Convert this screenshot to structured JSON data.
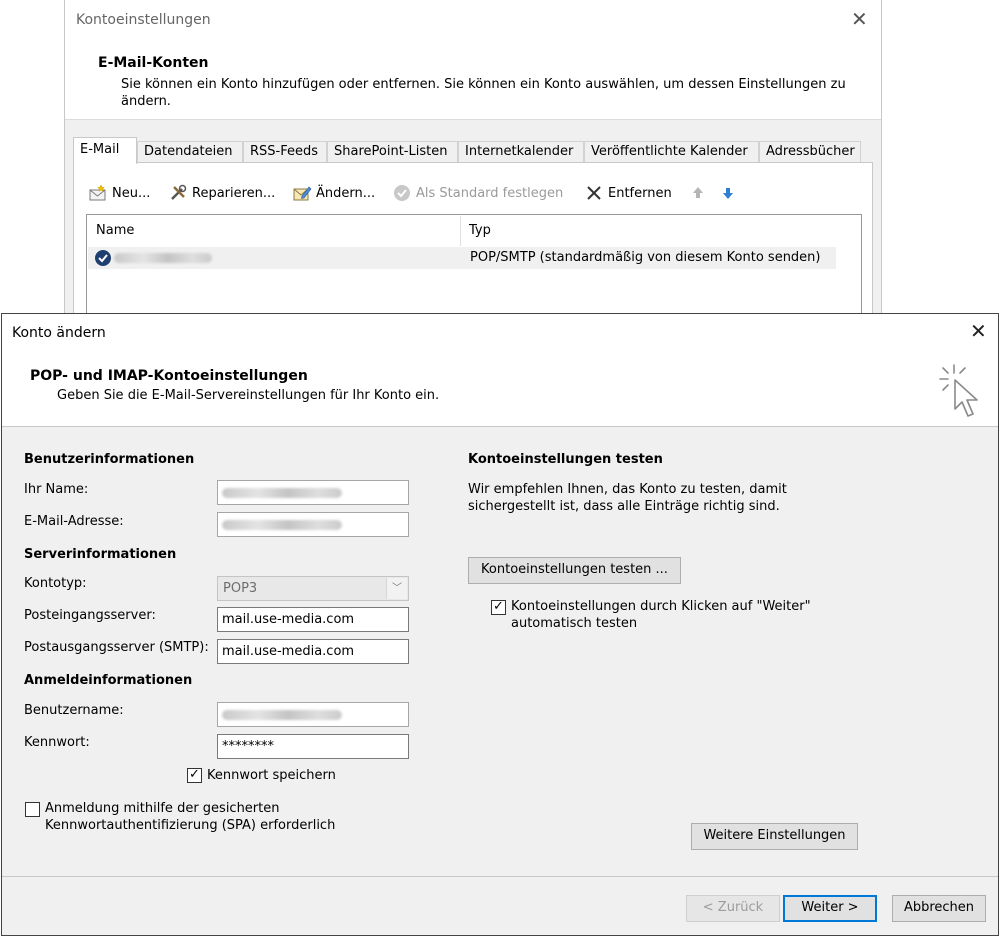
{
  "background_window": {
    "title": "Kontoeinstellungen",
    "close_glyph": "✕",
    "header_title": "E-Mail-Konten",
    "header_desc": "Sie können ein Konto hinzufügen oder entfernen. Sie können ein Konto auswählen, um dessen Einstellungen zu ändern.",
    "tabs": [
      "E-Mail",
      "Datendateien",
      "RSS-Feeds",
      "SharePoint-Listen",
      "Internetkalender",
      "Veröffentlichte Kalender",
      "Adressbücher"
    ],
    "toolbar": {
      "new_label": "Neu...",
      "repair_label": "Reparieren...",
      "change_label": "Ändern...",
      "set_default_label": "Als Standard festlegen",
      "remove_label": "Entfernen",
      "up_icon": "arrow-up-icon",
      "down_icon": "arrow-down-icon"
    },
    "account_list": {
      "col_name": "Name",
      "col_type": "Typ",
      "rows": [
        {
          "name": "",
          "type": "POP/SMTP (standardmäßig von diesem Konto senden)"
        }
      ]
    }
  },
  "dialog": {
    "title": "Konto ändern",
    "close_glyph": "✕",
    "header_title": "POP- und IMAP-Kontoeinstellungen",
    "header_desc": "Geben Sie die E-Mail-Servereinstellungen für Ihr Konto ein.",
    "user_info": {
      "section": "Benutzerinformationen",
      "name_label": "Ihr Name:",
      "email_label": "E-Mail-Adresse:"
    },
    "server_info": {
      "section": "Serverinformationen",
      "account_type_label": "Kontotyp:",
      "account_type_value": "POP3",
      "incoming_label": "Posteingangsserver:",
      "incoming_value": "mail.use-media.com",
      "outgoing_label": "Postausgangsserver (SMTP):",
      "outgoing_value": "mail.use-media.com"
    },
    "login_info": {
      "section": "Anmeldeinformationen",
      "username_label": "Benutzername:",
      "password_label": "Kennwort:",
      "password_value": "********",
      "remember_label": "Kennwort speichern",
      "remember_checked": true
    },
    "spa": {
      "label_line1": "Anmeldung mithilfe der gesicherten",
      "label_line2": "Kennwortauthentifizierung (SPA) erforderlich",
      "checked": false
    },
    "test": {
      "section": "Kontoeinstellungen testen",
      "desc_line1": "Wir empfehlen Ihnen, das Konto zu testen, damit",
      "desc_line2": "sichergestellt ist, dass alle Einträge richtig sind.",
      "button": "Kontoeinstellungen testen ...",
      "auto_line1": "Kontoeinstellungen durch Klicken auf \"Weiter\"",
      "auto_line2": "automatisch testen",
      "auto_checked": true
    },
    "more_settings_button": "Weitere Einstellungen",
    "footer": {
      "back": "< Zurück",
      "next": "Weiter >",
      "cancel": "Abbrechen"
    }
  }
}
